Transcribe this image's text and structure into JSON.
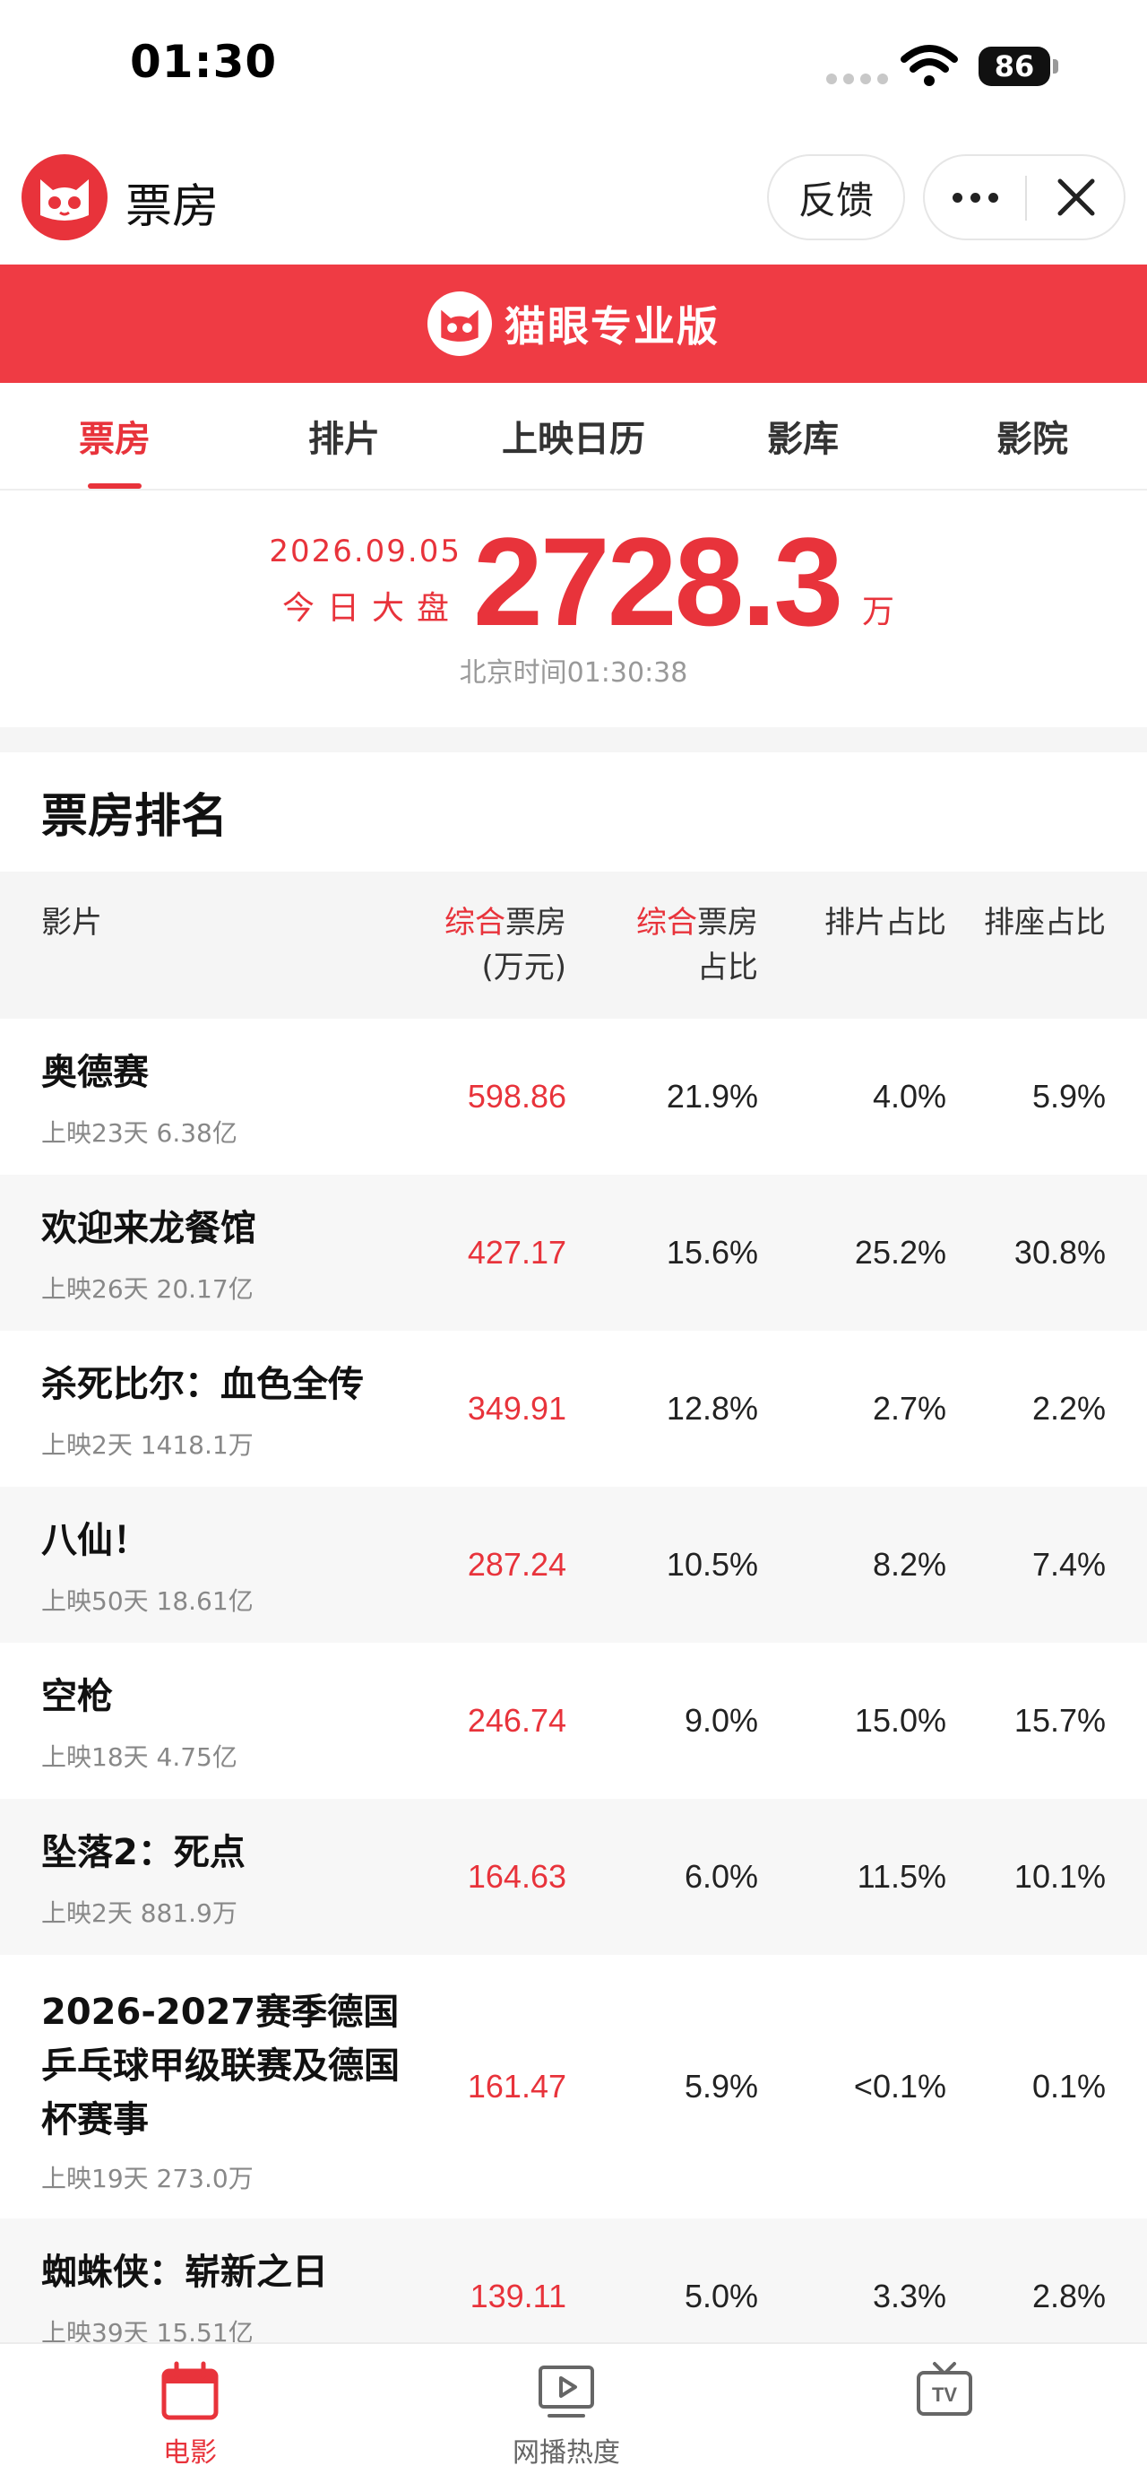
{
  "status_bar": {
    "time": "01:30",
    "battery": "86"
  },
  "header": {
    "title": "票房",
    "feedback_label": "反馈"
  },
  "banner": {
    "brand": "猫眼专业版"
  },
  "tabs": [
    {
      "label": "票房",
      "active": true
    },
    {
      "label": "排片"
    },
    {
      "label": "上映日历"
    },
    {
      "label": "影库"
    },
    {
      "label": "影院"
    }
  ],
  "summary": {
    "date": "2026.09.05",
    "label": "今日大盘",
    "value": "2728.3",
    "unit": "万",
    "beijing_time": "北京时间01:30:38"
  },
  "ranking": {
    "title": "票房排名",
    "headers": {
      "film": "影片",
      "box_hl": "综合",
      "box_rest": "票房",
      "box_unit": "(万元)",
      "share_hl": "综合",
      "share_rest": "票房",
      "share_line2": "占比",
      "schedule": "排片占比",
      "seat": "排座占比"
    },
    "rows": [
      {
        "name": "奥德赛",
        "sub": "上映23天  6.38亿",
        "box": "598.86",
        "share": "21.9%",
        "schedule": "4.0%",
        "seat": "5.9%"
      },
      {
        "name": "欢迎来龙餐馆",
        "sub": "上映26天  20.17亿",
        "box": "427.17",
        "share": "15.6%",
        "schedule": "25.2%",
        "seat": "30.8%"
      },
      {
        "name": "杀死比尔：血色全传",
        "sub": "上映2天  1418.1万",
        "box": "349.91",
        "share": "12.8%",
        "schedule": "2.7%",
        "seat": "2.2%"
      },
      {
        "name": "八仙！",
        "sub": "上映50天  18.61亿",
        "box": "287.24",
        "share": "10.5%",
        "schedule": "8.2%",
        "seat": "7.4%"
      },
      {
        "name": "空枪",
        "sub": "上映18天  4.75亿",
        "box": "246.74",
        "share": "9.0%",
        "schedule": "15.0%",
        "seat": "15.7%"
      },
      {
        "name": "坠落2：死点",
        "sub": "上映2天  881.9万",
        "box": "164.63",
        "share": "6.0%",
        "schedule": "11.5%",
        "seat": "10.1%"
      },
      {
        "name": "2026-2027赛季德国乒乓球甲级联赛及德国杯赛事",
        "sub": "上映19天  273.0万",
        "box": "161.47",
        "share": "5.9%",
        "schedule": "<0.1%",
        "seat": "0.1%"
      },
      {
        "name": "蜘蛛侠：崭新之日",
        "sub": "上映39天  15.51亿",
        "box": "139.11",
        "share": "5.0%",
        "schedule": "3.3%",
        "seat": "2.8%"
      }
    ]
  },
  "bottom_nav": [
    {
      "label": "电影",
      "icon": "calendar-icon",
      "active": true
    },
    {
      "label": "网播热度",
      "icon": "play-screen-icon"
    },
    {
      "label": "",
      "icon": "tv-icon"
    }
  ],
  "colors": {
    "brand_red": "#e8333b",
    "banner_red": "#ef3b44"
  }
}
